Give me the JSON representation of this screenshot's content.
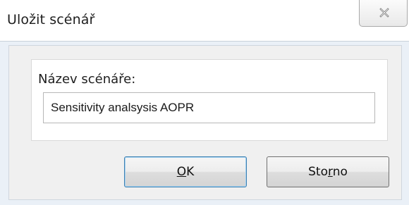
{
  "window": {
    "title": "Uložit scénář",
    "close_icon": "close-icon"
  },
  "form": {
    "scenario_name_label": "Název scénáře:",
    "scenario_name_value": "Sensitivity analsysis AOPR"
  },
  "buttons": {
    "ok": {
      "before": "",
      "mnemonic": "O",
      "after": "K"
    },
    "cancel": {
      "before": "Sto",
      "mnemonic": "r",
      "after": "no"
    }
  },
  "colors": {
    "window_bg": "#eaf0f7",
    "panel_bg": "#f0f0f0",
    "default_button_border": "#3c7fb1"
  }
}
